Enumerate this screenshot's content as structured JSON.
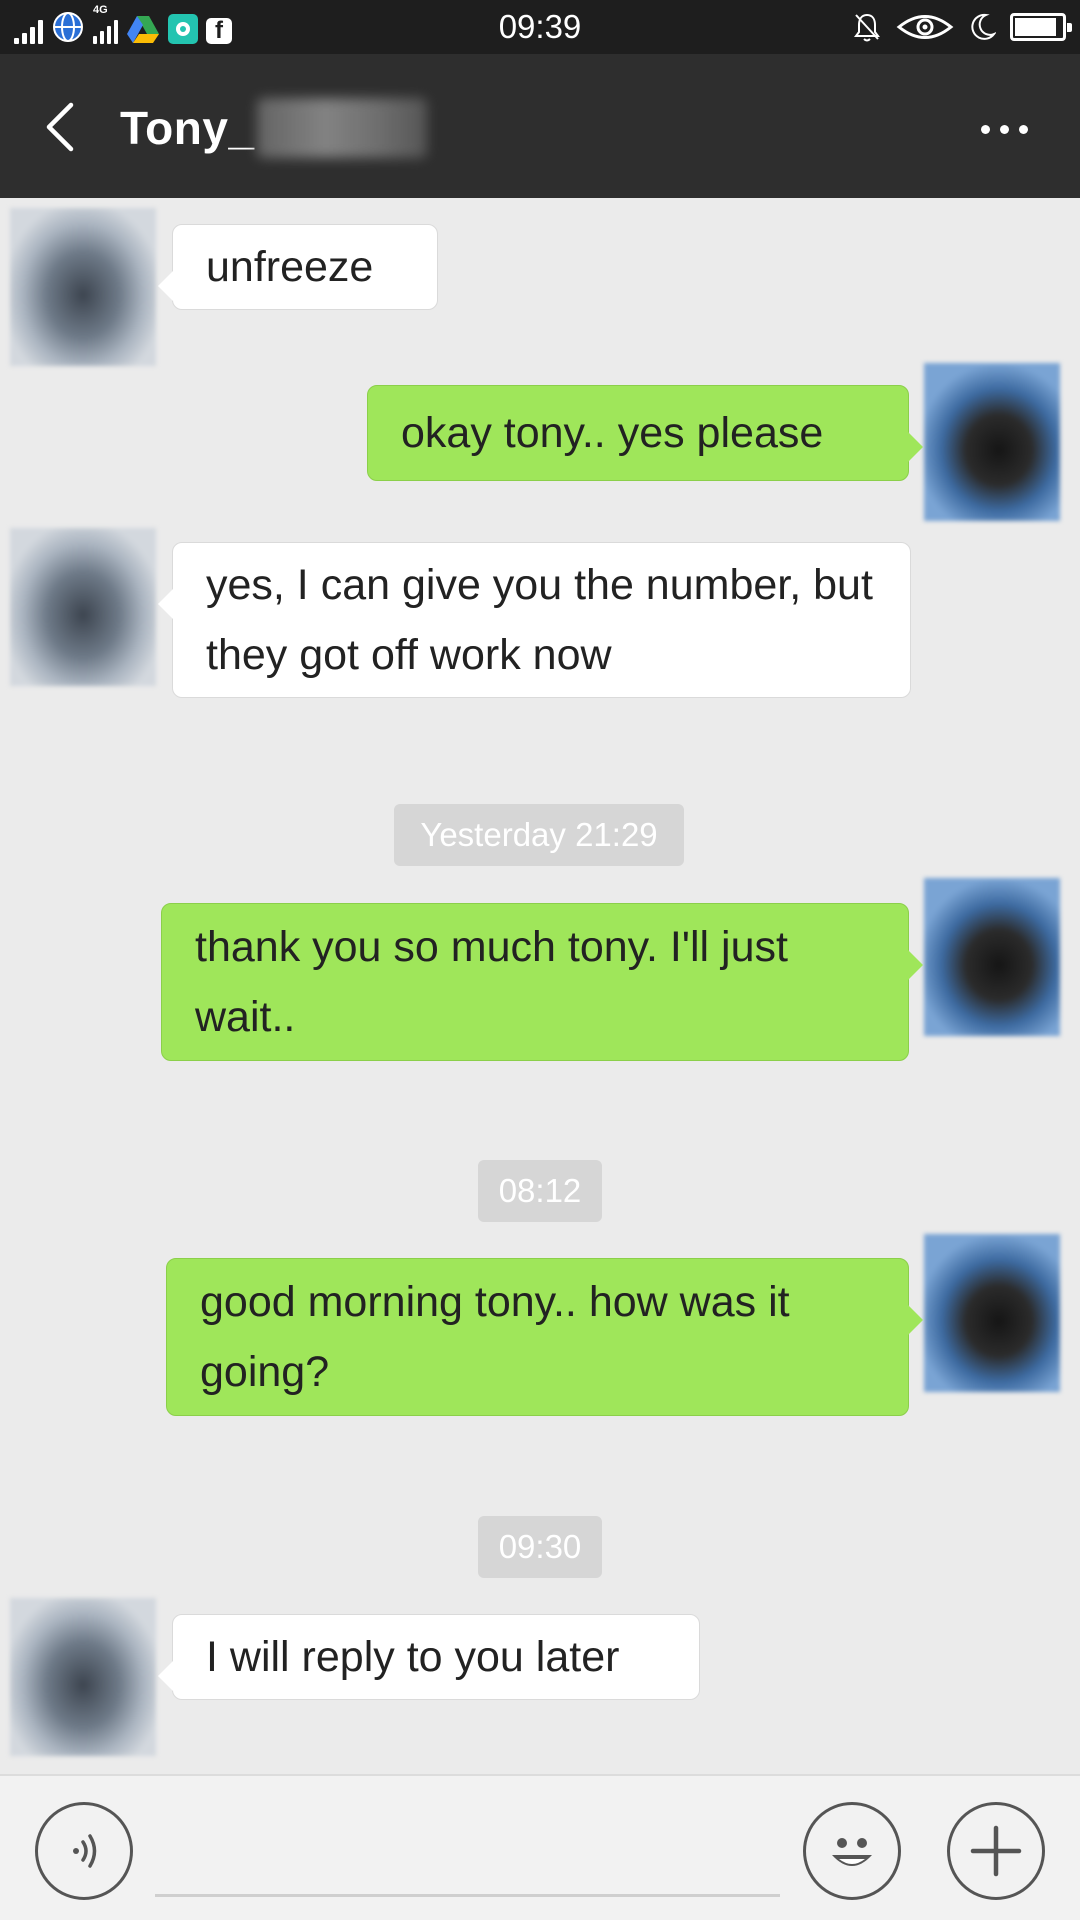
{
  "status_bar": {
    "time": "09:39",
    "network_label": "4G",
    "facebook_glyph": "f",
    "battery_level": 0.9,
    "icons": [
      "signal-bars",
      "globe",
      "signal-4g",
      "drive",
      "chat-app",
      "facebook",
      "mute-bell",
      "eye",
      "moon",
      "battery"
    ]
  },
  "header": {
    "title": "Tony_",
    "back_icon": "chevron-left",
    "more_icon": "more-dots"
  },
  "messages": [
    {
      "direction": "in",
      "text": "unfreeze"
    },
    {
      "direction": "out",
      "text": "okay tony.. yes please"
    },
    {
      "direction": "in",
      "text": "yes, I can give you the number, but they got off work now"
    },
    {
      "timestamp": "Yesterday 21:29"
    },
    {
      "direction": "out",
      "text": "thank you so much tony. I'll just wait.."
    },
    {
      "timestamp": "08:12"
    },
    {
      "direction": "out",
      "text": "good morning tony.. how was it going?"
    },
    {
      "timestamp": "09:30"
    },
    {
      "direction": "in",
      "text": "I will reply to you later"
    }
  ],
  "input_bar": {
    "voice_icon": "voice",
    "emoji_icon": "emoji",
    "plus_icon": "plus"
  },
  "colors": {
    "header_bg": "#2e2e2e",
    "chat_bg": "#ebebeb",
    "outgoing_bubble": "#9fe65a",
    "incoming_bubble": "#ffffff",
    "timestamp_bg": "#d6d6d6"
  }
}
